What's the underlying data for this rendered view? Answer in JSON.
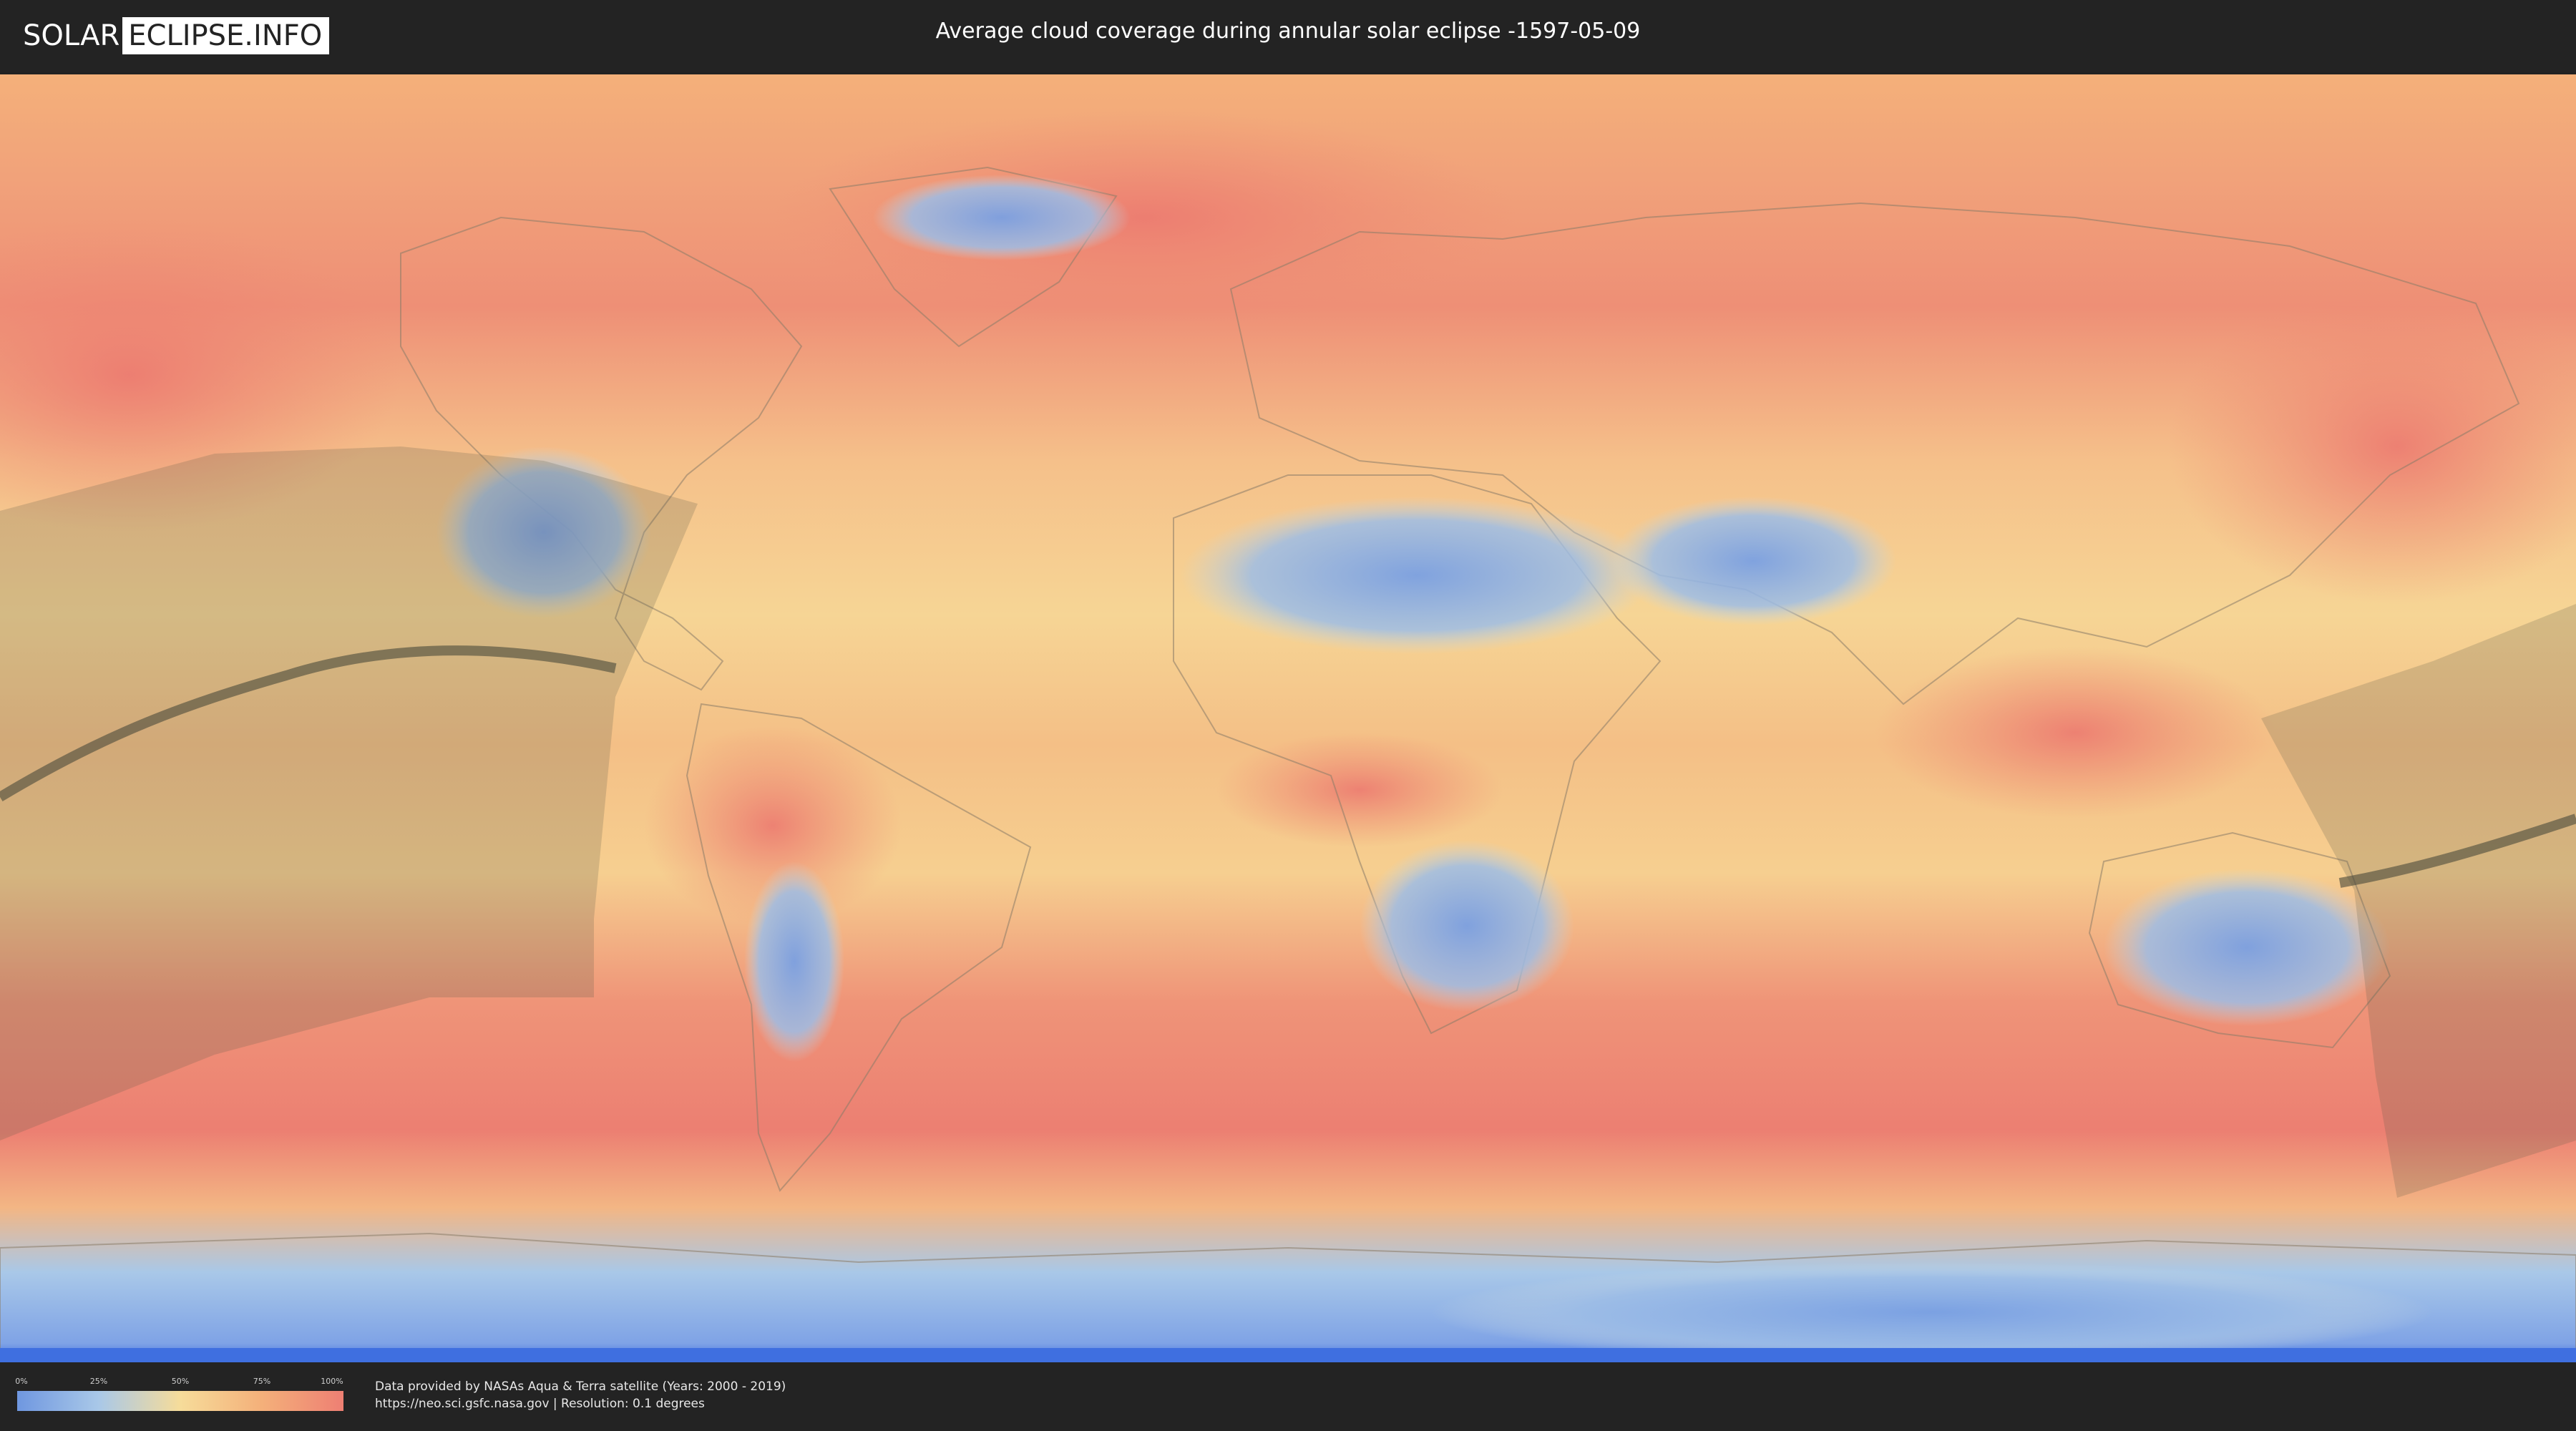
{
  "header": {
    "logo_left": "SOLAR",
    "logo_right": "ECLIPSE.INFO",
    "title": "Average cloud coverage during annular solar eclipse -1597-05-09"
  },
  "legend": {
    "ticks": [
      "0%",
      "25%",
      "50%",
      "75%",
      "100%"
    ],
    "colors": [
      "#6f97e0",
      "#a9c8e8",
      "#f6dc9a",
      "#f4b07a",
      "#ee7f73"
    ]
  },
  "credits": {
    "line1": "Data provided by NASAs Aqua & Terra satellite (Years: 2000 - 2019)",
    "line2": "https://neo.sci.gsfc.nasa.gov | Resolution: 0.1 degrees"
  },
  "map": {
    "projection": "equirectangular",
    "colors": {
      "clear": "#6f97e0",
      "light": "#a9c8e8",
      "mid": "#f6dc9a",
      "heavy": "#f4b07a",
      "overcast": "#ee7f73",
      "shadow": "#5a5a4a",
      "track": "#4a4a3a"
    }
  }
}
